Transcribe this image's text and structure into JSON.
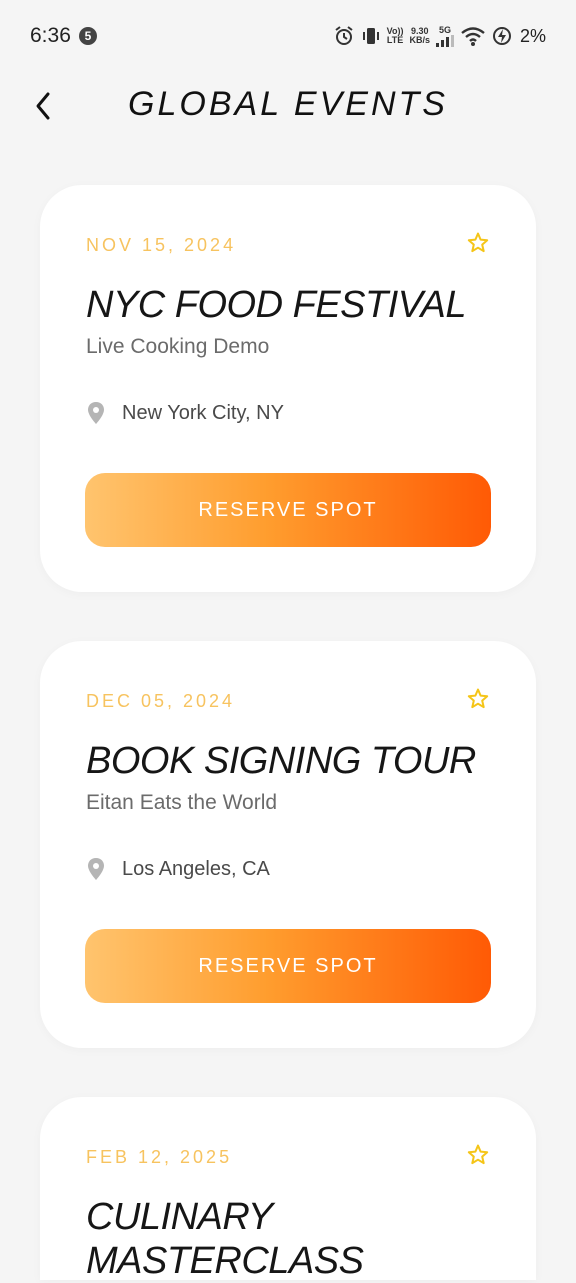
{
  "status_bar": {
    "time": "6:36",
    "notification_badge": "5",
    "volte_line1": "Vo))",
    "volte_line2": "LTE",
    "speed_value": "9.30",
    "speed_unit": "KB/s",
    "network": "5G",
    "battery": "2%"
  },
  "header": {
    "title": "GLOBAL EVENTS",
    "back_icon": "chevron-left-icon"
  },
  "events": [
    {
      "date": "NOV 15, 2024",
      "title": "NYC FOOD FESTIVAL",
      "subtitle": "Live Cooking Demo",
      "location": "New York City, NY",
      "button_label": "RESERVE SPOT"
    },
    {
      "date": "DEC 05, 2024",
      "title": "BOOK SIGNING TOUR",
      "subtitle": "Eitan Eats the World",
      "location": "Los Angeles, CA",
      "button_label": "RESERVE SPOT"
    },
    {
      "date": "FEB 12, 2025",
      "title": "CULINARY MASTERCLASS",
      "subtitle": "",
      "location": "",
      "button_label": ""
    }
  ],
  "colors": {
    "accent_date": "#f7c35f",
    "star": "#f5c518",
    "button_gradient_start": "#ffc46e",
    "button_gradient_end": "#ff5a05",
    "background": "#f5f5f5",
    "card": "#ffffff"
  }
}
